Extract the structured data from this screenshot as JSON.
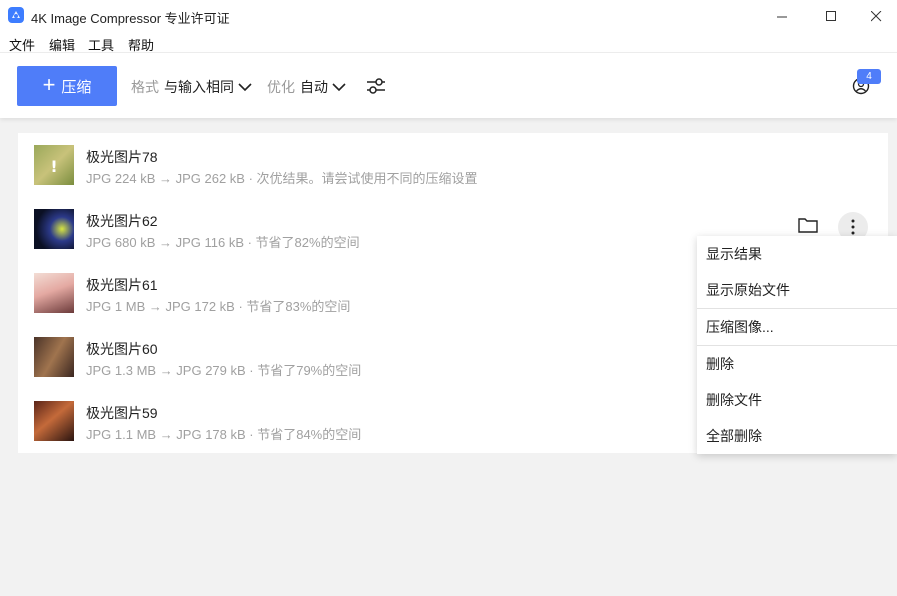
{
  "window": {
    "title": "4K Image Compressor 专业许可证"
  },
  "menu": [
    "文件",
    "编辑",
    "工具",
    "帮助"
  ],
  "toolbar": {
    "compress_label": "压缩",
    "format_key": "格式",
    "format_value": "与输入相同",
    "optimize_key": "优化",
    "optimize_value": "自动",
    "account_badge": "4",
    "accent_color": "#4f7df9"
  },
  "items": [
    {
      "title": "极光图片78",
      "subtitle": "JPG 224 kB → JPG 262 kB · 次优结果。请尝试使用不同的压缩设置",
      "thumb_icon": "warning-exclamation-icon"
    },
    {
      "title": "极光图片62",
      "subtitle": "JPG 680 kB → JPG 116 kB · 节省了82%的空间"
    },
    {
      "title": "极光图片61",
      "subtitle": "JPG 1 MB → JPG 172 kB · 节省了83%的空间"
    },
    {
      "title": "极光图片60",
      "subtitle": "JPG 1.3 MB → JPG 279 kB · 节省了79%的空间"
    },
    {
      "title": "极光图片59",
      "subtitle": "JPG 1.1 MB → JPG 178 kB · 节省了84%的空间"
    }
  ],
  "context_menu": [
    "显示结果",
    "显示原始文件",
    "压缩图像...",
    "删除",
    "删除文件",
    "全部删除"
  ]
}
